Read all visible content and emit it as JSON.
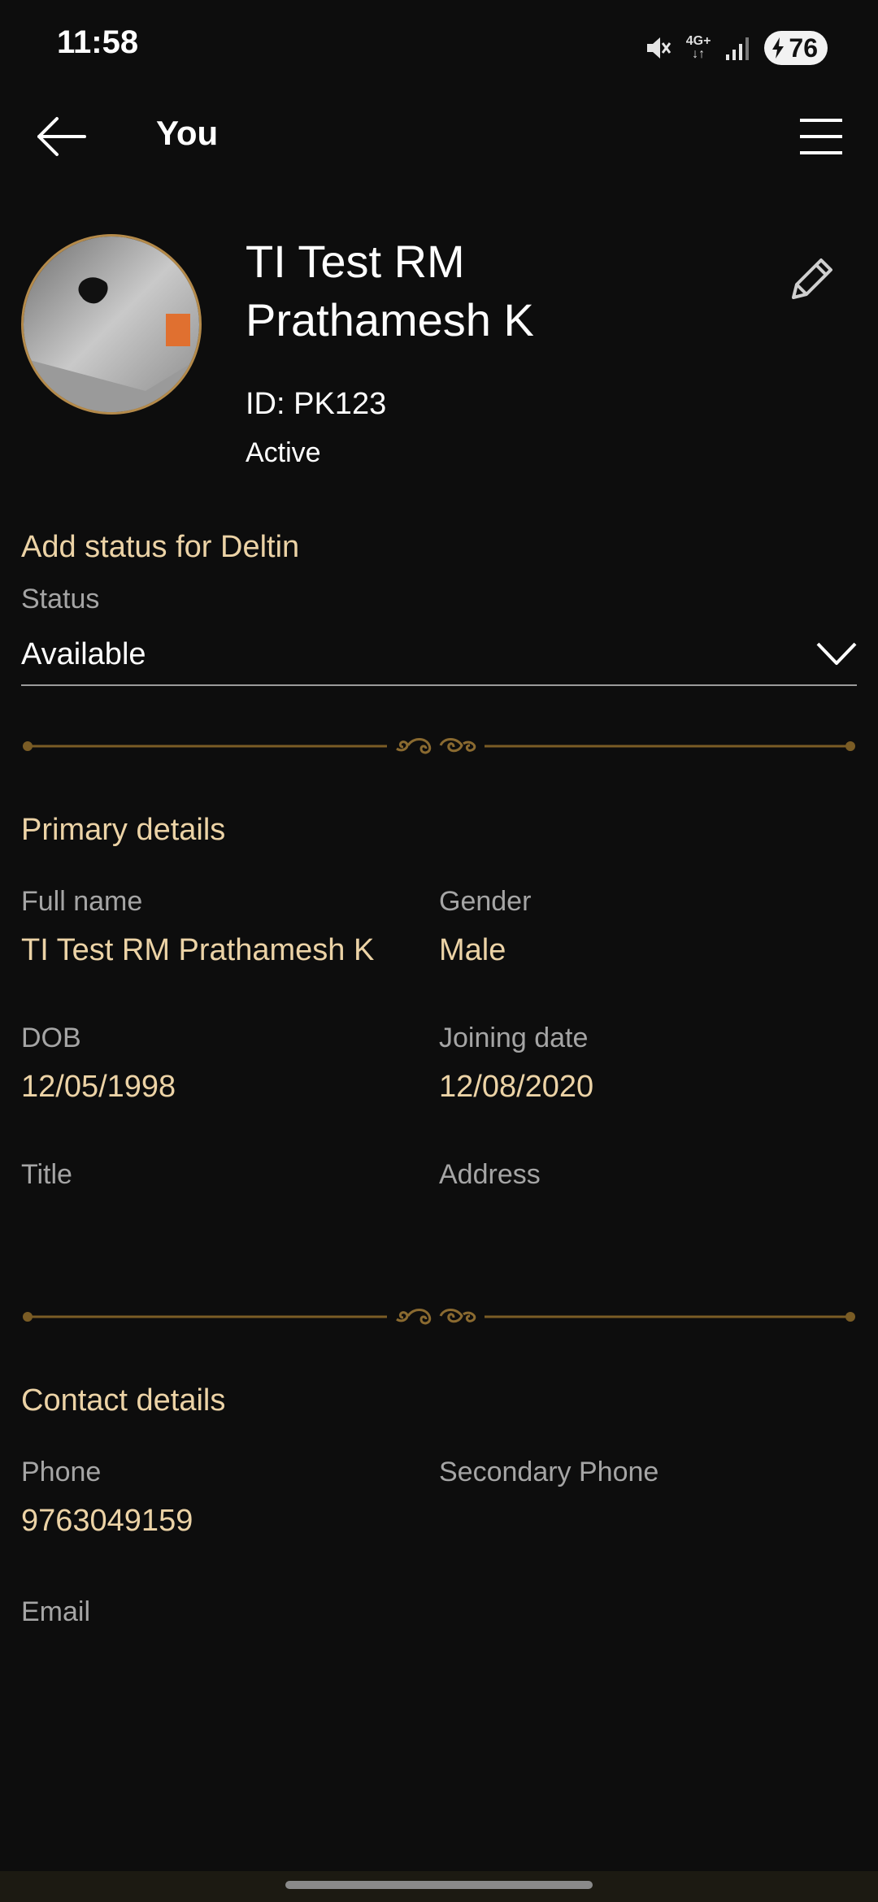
{
  "status_bar": {
    "time": "11:58",
    "network": "4G+",
    "battery": "76"
  },
  "header": {
    "title": "You",
    "back_icon": "arrow-left-icon",
    "menu_icon": "hamburger-menu-icon"
  },
  "profile": {
    "name": "TI Test RM Prathamesh K",
    "name_line1": "TI Test RM",
    "name_line2": "Prathamesh K",
    "id": "ID: PK123",
    "state": "Active",
    "edit_icon": "pencil-icon"
  },
  "availability": {
    "title": "Add status for Deltin",
    "label": "Status",
    "value": "Available"
  },
  "primary": {
    "title": "Primary details",
    "fields": [
      {
        "label": "Full name",
        "value": "TI Test RM Prathamesh K"
      },
      {
        "label": "Gender",
        "value": "Male"
      },
      {
        "label": "DOB",
        "value": "12/05/1998"
      },
      {
        "label": "Joining date",
        "value": "12/08/2020"
      },
      {
        "label": "Title",
        "value": ""
      },
      {
        "label": "Address",
        "value": ""
      }
    ]
  },
  "contact": {
    "title": "Contact details",
    "fields": [
      {
        "label": "Phone",
        "value": "9763049159"
      },
      {
        "label": "Secondary Phone",
        "value": ""
      },
      {
        "label": "Email",
        "value": ""
      }
    ]
  },
  "colors": {
    "background": "#0d0d0d",
    "accent_gold": "#ecd3a6",
    "divider_gold": "#7a5c25",
    "label_gray": "#a5a5a5"
  }
}
